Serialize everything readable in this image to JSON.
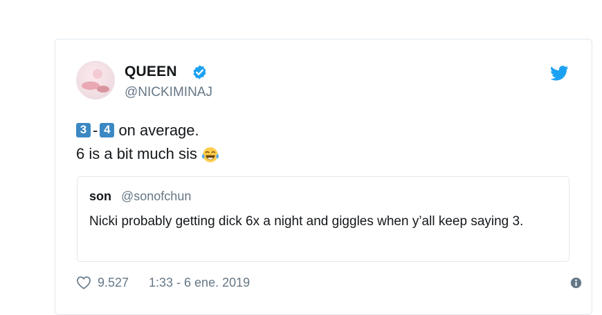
{
  "tweet": {
    "display_name": "QUEEN",
    "handle": "@NICKIMINAJ",
    "icons": {
      "verified": "verified-badge-icon",
      "brand": "twitter-bird-icon"
    },
    "text": {
      "keycap_1": "3",
      "dash": "-",
      "keycap_2": "4",
      "line1_rest": " on average.",
      "line2": "6 is a bit much sis"
    },
    "quote": {
      "name": "son",
      "handle": "@sonofchun",
      "text": "Nicki probably getting dick 6x a night and giggles when y’all keep saying 3."
    },
    "footer": {
      "like_count": "9.527",
      "timestamp": "1:33 - 6 ene. 2019"
    },
    "colors": {
      "verified": "#1da1f2",
      "bird": "#1da1f2",
      "keycap": "#3b88c3",
      "secondary_text": "#657786",
      "border": "#e1e8ed"
    }
  }
}
